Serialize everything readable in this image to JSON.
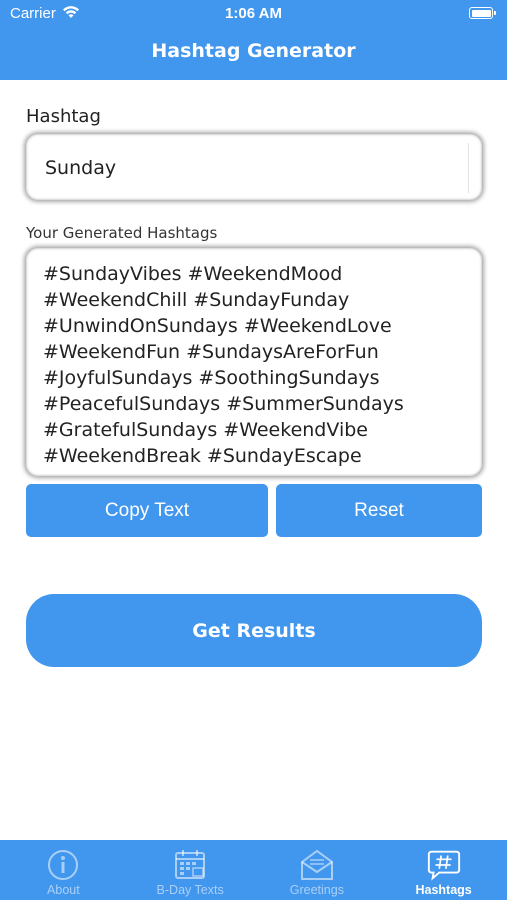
{
  "status_bar": {
    "carrier": "Carrier",
    "time": "1:06 AM"
  },
  "header": {
    "title": "Hashtag Generator"
  },
  "form": {
    "hashtag_label": "Hashtag",
    "hashtag_value": "Sunday",
    "generated_label": "Your Generated Hashtags",
    "generated_text": "#SundayVibes #WeekendMood\n#WeekendChill #SundayFunday\n#UnwindOnSundays #WeekendLove\n#WeekendFun #SundaysAreForFun\n#JoyfulSundays #SoothingSundays\n#PeacefulSundays #SummerSundays\n#GratefulSundays #WeekendVibe\n#WeekendBreak #SundayEscape"
  },
  "buttons": {
    "copy": "Copy Text",
    "reset": "Reset",
    "get_results": "Get Results"
  },
  "tabbar": {
    "items": [
      {
        "label": "About",
        "icon": "info-icon"
      },
      {
        "label": "B-Day Texts",
        "icon": "calendar-icon"
      },
      {
        "label": "Greetings",
        "icon": "envelope-icon"
      },
      {
        "label": "Hashtags",
        "icon": "hashtag-bubble-icon"
      }
    ],
    "active": "Hashtags"
  },
  "colors": {
    "accent": "#4196ee",
    "text": "#222222",
    "background": "#ffffff"
  }
}
